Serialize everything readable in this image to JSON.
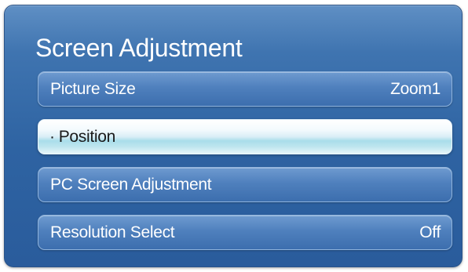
{
  "menu": {
    "title": "Screen Adjustment",
    "items": [
      {
        "label": "Picture Size",
        "value": "Zoom1"
      },
      {
        "label": "Position",
        "bullet": "·"
      },
      {
        "label": "PC Screen Adjustment"
      },
      {
        "label": "Resolution Select",
        "value": "Off"
      }
    ]
  },
  "colors": {
    "panel": "#3f74b0",
    "item": "#4f80bd",
    "selected": "#a9ddea",
    "text": "#ffffff"
  }
}
